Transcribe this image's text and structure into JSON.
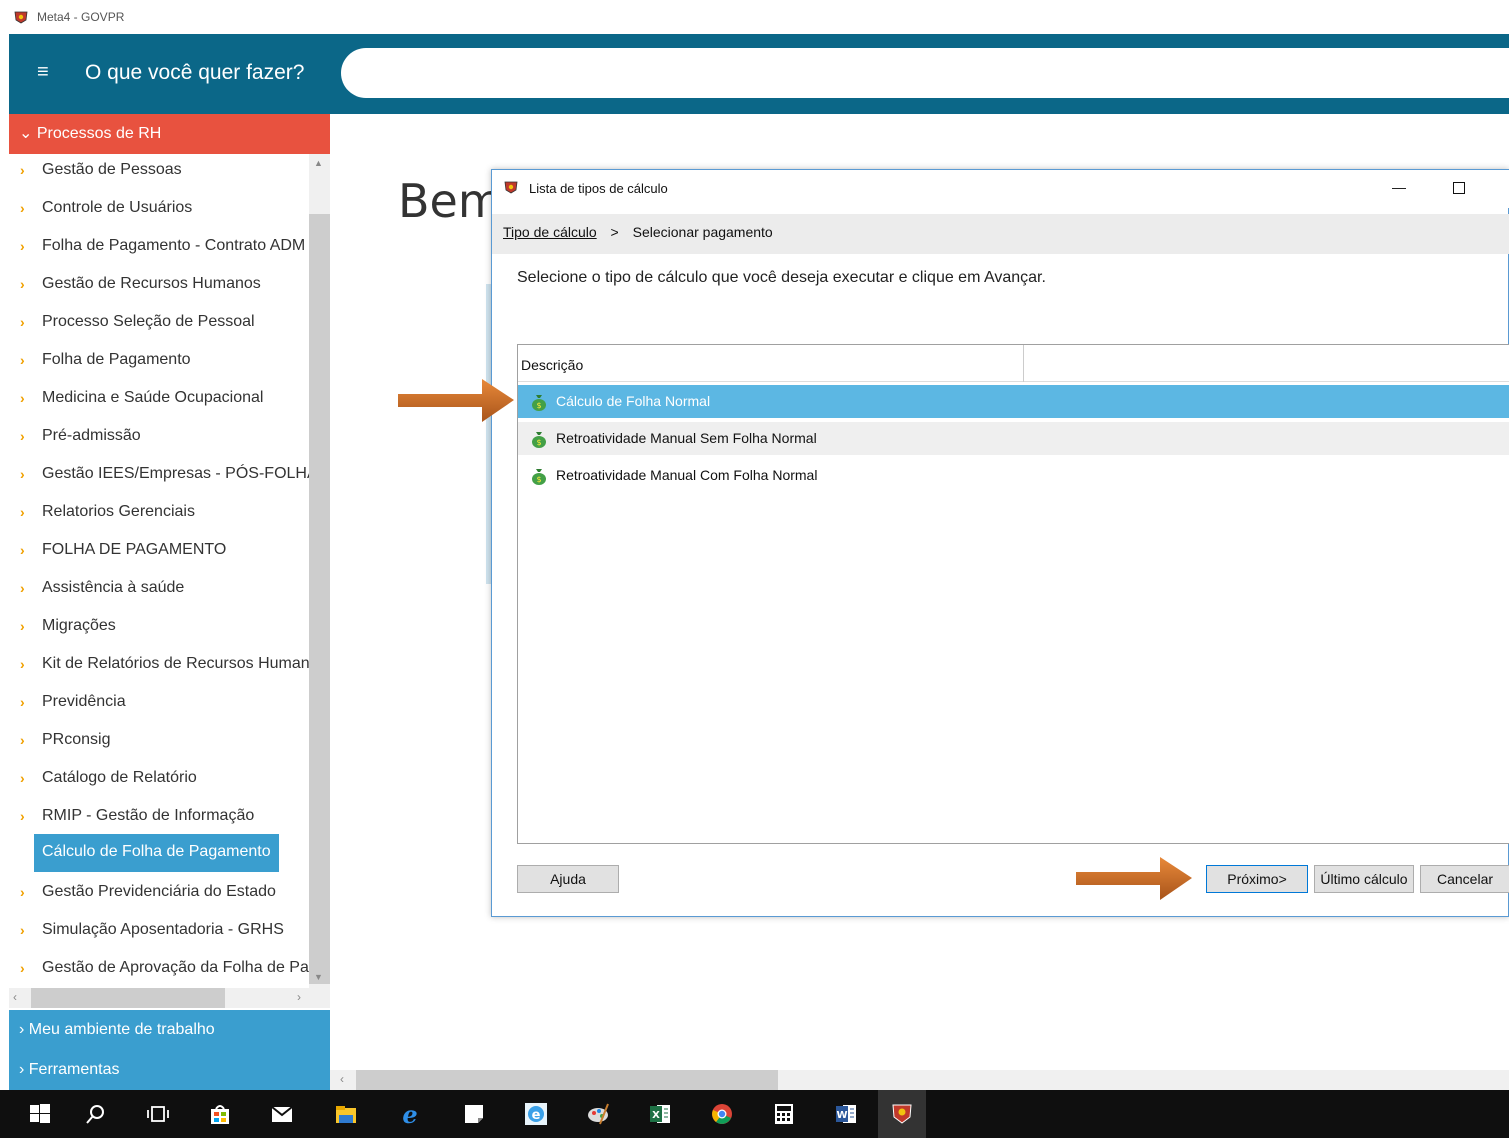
{
  "window": {
    "title": "Meta4 - GOVPR"
  },
  "header": {
    "menu_glyph": "≡",
    "prompt": "O que você quer fazer?",
    "search_placeholder": ""
  },
  "sidebar": {
    "section_title": "Processos de RH",
    "items": [
      {
        "label": "Gestão de Pessoas"
      },
      {
        "label": "Controle de Usuários"
      },
      {
        "label": "Folha de Pagamento - Contrato ADM"
      },
      {
        "label": "Gestão de Recursos Humanos"
      },
      {
        "label": "Processo Seleção de Pessoal"
      },
      {
        "label": "Folha de Pagamento"
      },
      {
        "label": "Medicina e Saúde Ocupacional"
      },
      {
        "label": "Pré-admissão"
      },
      {
        "label": "Gestão IEES/Empresas - PÓS-FOLHA"
      },
      {
        "label": "Relatorios Gerenciais"
      },
      {
        "label": "FOLHA DE PAGAMENTO"
      },
      {
        "label": "Assistência à saúde"
      },
      {
        "label": "Migrações"
      },
      {
        "label": "Kit de Relatórios de Recursos Humanos"
      },
      {
        "label": "Previdência"
      },
      {
        "label": "PRconsig"
      },
      {
        "label": "Catálogo de Relatório"
      },
      {
        "label": "RMIP - Gestão de Informação"
      },
      {
        "label": "Cálculo de Folha de Pagamento",
        "active": true
      },
      {
        "label": "Gestão Previdenciária do Estado"
      },
      {
        "label": "Simulação Aposentadoria - GRHS"
      },
      {
        "label": "Gestão de Aprovação da Folha de Pagamento"
      }
    ],
    "footer_sections": [
      {
        "label": "Meu ambiente de trabalho"
      },
      {
        "label": "Ferramentas"
      }
    ]
  },
  "main": {
    "welcome_text": "Bem"
  },
  "dialog": {
    "title": "Lista de tipos de cálculo",
    "breadcrumb": {
      "link": "Tipo de cálculo",
      "separator": ">",
      "current": "Selecionar pagamento"
    },
    "instruction": "Selecione o tipo de cálculo que você deseja executar e clique em Avançar.",
    "grid": {
      "column_header": "Descrição",
      "rows": [
        {
          "label": "Cálculo de Folha Normal",
          "selected": true
        },
        {
          "label": "Retroatividade Manual Sem Folha Normal"
        },
        {
          "label": "Retroatividade Manual Com Folha Normal"
        }
      ]
    },
    "buttons": {
      "help": "Ajuda",
      "next": "Próximo>",
      "last_calc": "Último cálculo",
      "cancel": "Cancelar"
    }
  },
  "colors": {
    "header_bg": "#0b6788",
    "section_active": "#e8523f",
    "section_collapsed": "#3a9ecf",
    "selected_row": "#5cb7e3",
    "chevron": "#f0a000",
    "arrow": "#d4701f"
  },
  "taskbar": {
    "icons": [
      "windows-start-icon",
      "search-icon",
      "task-view-icon",
      "store-icon",
      "mail-icon",
      "file-explorer-icon",
      "edge-icon",
      "sticky-notes-icon",
      "ie-icon",
      "paint-icon",
      "excel-icon",
      "chrome-icon",
      "calculator-icon",
      "word-icon",
      "meta4-icon"
    ]
  }
}
